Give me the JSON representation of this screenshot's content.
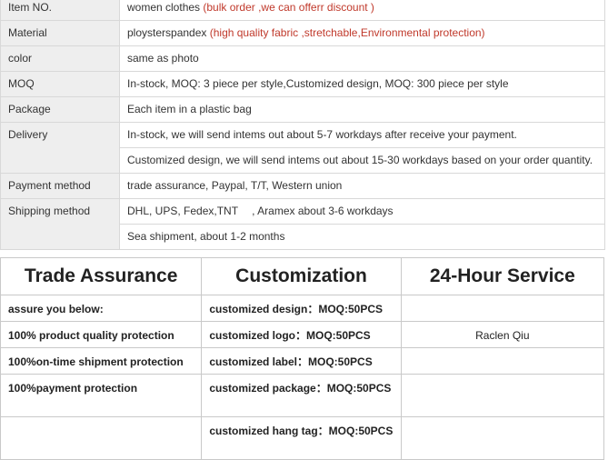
{
  "spec": {
    "rows": [
      {
        "label": "Item NO.",
        "value": "women clothes",
        "note": "(bulk order ,we can offerr discount )"
      },
      {
        "label": "Material",
        "value": "ploysterspandex",
        "note": "(high quality fabric ,stretchable,Environmental protection)"
      },
      {
        "label": "color",
        "value": "same as photo",
        "note": ""
      },
      {
        "label": "MOQ",
        "value": "In-stock, MOQ: 3 piece per style,Customized design, MOQ: 300 piece per style",
        "note": ""
      },
      {
        "label": "Package",
        "value": "Each item in a plastic bag",
        "note": ""
      },
      {
        "label": "Delivery",
        "value": "In-stock, we will send intems out about 5-7 workdays after receive your payment.",
        "note": ""
      },
      {
        "label": "",
        "value": "Customized design, we will send intems out about 15-30 workdays based on your order quantity.",
        "note": ""
      },
      {
        "label": "Payment method",
        "value": "trade assurance, Paypal, T/T, Western union",
        "note": ""
      },
      {
        "label": "Shipping method",
        "value": "DHL, UPS, Fedex,TNT 　, Aramex about 3-6 workdays",
        "note": ""
      },
      {
        "label": "",
        "value": "Sea shipment, about 1-2 months",
        "note": ""
      }
    ]
  },
  "assurance": {
    "headers": [
      "Trade Assurance",
      "Customization",
      "24-Hour Service"
    ],
    "col1": [
      "assure you below:",
      "100% product quality protection",
      "100%on-time shipment protection",
      "100%payment protection"
    ],
    "col2": [
      "customized design：MOQ:50PCS",
      "customized logo：MOQ:50PCS",
      "customized label：MOQ:50PCS",
      "customized package：MOQ:50PCS",
      "customized hang tag：MOQ:50PCS"
    ],
    "service_name": "Raclen Qiu"
  }
}
